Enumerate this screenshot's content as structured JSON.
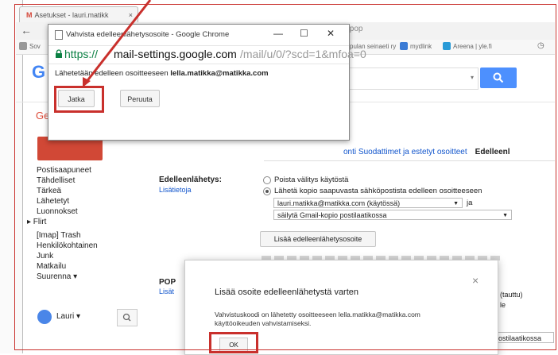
{
  "browser": {
    "tab_title": "Asetukset - lauri.matikk",
    "tab_close": "×",
    "url_tail": "dlpop",
    "bookmarks": [
      {
        "label": "Sov"
      },
      {
        "label": "pulan seinaeti ry"
      },
      {
        "label": "mydlink"
      },
      {
        "label": "Areena | yle.fi"
      }
    ]
  },
  "popup": {
    "title": "Vahvista edelleenlähetysosoite - Google Chrome",
    "minimize": "—",
    "maximize": "☐",
    "close": "✕",
    "url_scheme": "https://",
    "url_host": "mail-settings.google.com",
    "url_path": "/mail/u/0/?scd=1&mfoa=0",
    "message_prefix": "Lähetetään edelleen osoitteeseen",
    "message_email": "lella.matikka@matikka.com",
    "continue_label": "Jatka",
    "cancel_label": "Peruuta"
  },
  "gmail": {
    "logo_letter": "G",
    "ge_text": "Ge",
    "settings_tabs_left": "onti  Suodattimet ja estetyt osoitteet",
    "settings_tab_active": "Edelleenl",
    "nav": [
      "Postisaapuneet",
      "Tähdelliset",
      "Tärkeä",
      "Lähetetyt",
      "Luonnokset",
      "▸ Flirt",
      "[Imap] Trash",
      "Henkilökohtainen",
      "Junk",
      "Matkailu",
      "Suurenna ▾"
    ],
    "forwarding": {
      "heading": "Edelleenlähetys:",
      "learn_more": "Lisätietoja",
      "option_disable": "Poista välitys käytöstä",
      "option_forward": "Lähetä kopio saapuvasta sähköpostista edelleen osoitteeseen",
      "address_select": "lauri.matikka@matikka.com (käytössä)",
      "ja": "ja",
      "keep_select": "säilytä Gmail-kopio postilaatikossa",
      "add_address_button": "Lisää edelleenlähetysosoite"
    },
    "pop": {
      "heading": "POP",
      "link": "Lisät"
    },
    "right_fragments": [
      "(tauttu)",
      "le"
    ],
    "bottom_field": "ostilaatikossa",
    "user": {
      "name": "Lauri",
      "caret": "▾"
    }
  },
  "dialog": {
    "title": "Lisää osoite edelleenlähetystä varten",
    "close": "×",
    "text": "Vahvistuskoodi on lähetetty osoitteeseen lella.matikka@matikka.com käyttöoikeuden vahvistamiseksi.",
    "ok_label": "OK"
  },
  "colors": {
    "highlight": "#c9302c",
    "compose": "#d14836",
    "link": "#1155cc",
    "search_button": "#4d90fe",
    "https_green": "#0b8043"
  }
}
